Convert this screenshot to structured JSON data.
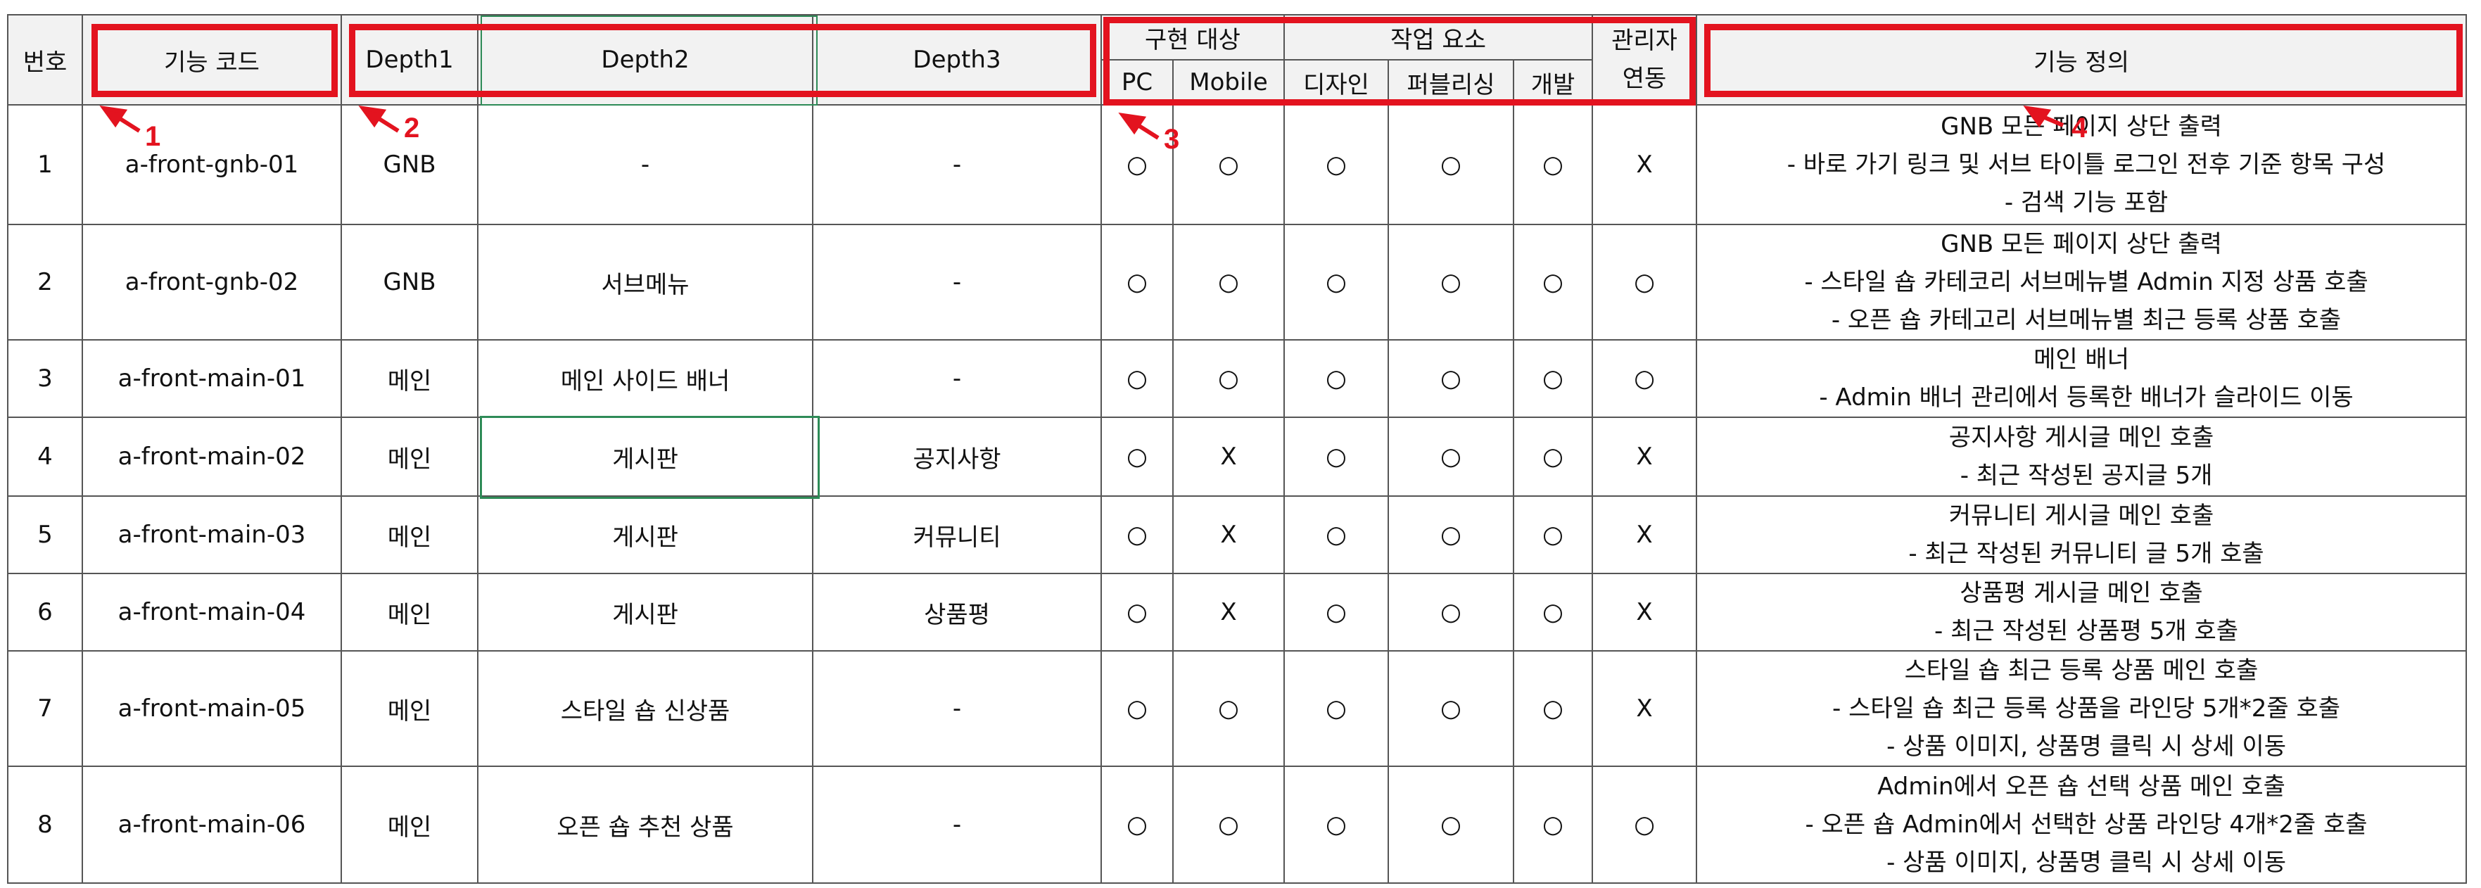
{
  "header": {
    "no": "번호",
    "code": "기능 코드",
    "depth1": "Depth1",
    "depth2": "Depth2",
    "depth3": "Depth3",
    "target_group": "구현 대상",
    "pc": "PC",
    "mobile": "Mobile",
    "work_group": "작업 요소",
    "design": "디자인",
    "publishing": "퍼블리싱",
    "dev": "개발",
    "admin_line1": "관리자",
    "admin_line2": "연동",
    "definition": "기능 정의"
  },
  "rows": [
    {
      "no": "1",
      "code": "a-front-gnb-01",
      "d1": "GNB",
      "d2": "-",
      "d3": "-",
      "pc": "○",
      "mobile": "○",
      "design": "○",
      "pub": "○",
      "dev": "○",
      "admin": "X",
      "def": [
        "GNB 모든 페이지 상단 출력",
        "- 바로 가기 링크 및 서브 타이틀 로그인 전후 기준 항목 구성",
        "- 검색 기능 포함"
      ]
    },
    {
      "no": "2",
      "code": "a-front-gnb-02",
      "d1": "GNB",
      "d2": "서브메뉴",
      "d3": "-",
      "pc": "○",
      "mobile": "○",
      "design": "○",
      "pub": "○",
      "dev": "○",
      "admin": "○",
      "def": [
        "GNB 모든 페이지 상단 출력",
        "- 스타일 숍 카테코리 서브메뉴별 Admin 지정 상품 호출",
        "- 오픈 숍 카테고리 서브메뉴별 최근 등록 상품 호출"
      ]
    },
    {
      "no": "3",
      "code": "a-front-main-01",
      "d1": "메인",
      "d2": "메인 사이드 배너",
      "d3": "-",
      "pc": "○",
      "mobile": "○",
      "design": "○",
      "pub": "○",
      "dev": "○",
      "admin": "○",
      "def": [
        "메인 배너",
        "- Admin 배너 관리에서 등록한 배너가 슬라이드 이동"
      ]
    },
    {
      "no": "4",
      "code": "a-front-main-02",
      "d1": "메인",
      "d2": "게시판",
      "d3": "공지사항",
      "pc": "○",
      "mobile": "X",
      "design": "○",
      "pub": "○",
      "dev": "○",
      "admin": "X",
      "def": [
        "공지사항 게시글 메인 호출",
        "- 최근 작성된 공지글 5개"
      ]
    },
    {
      "no": "5",
      "code": "a-front-main-03",
      "d1": "메인",
      "d2": "게시판",
      "d3": "커뮤니티",
      "pc": "○",
      "mobile": "X",
      "design": "○",
      "pub": "○",
      "dev": "○",
      "admin": "X",
      "def": [
        "커뮤니티 게시글 메인 호출",
        "- 최근 작성된 커뮤니티 글 5개 호출"
      ]
    },
    {
      "no": "6",
      "code": "a-front-main-04",
      "d1": "메인",
      "d2": "게시판",
      "d3": "상품평",
      "pc": "○",
      "mobile": "X",
      "design": "○",
      "pub": "○",
      "dev": "○",
      "admin": "X",
      "def": [
        "상품평 게시글 메인 호출",
        "- 최근 작성된 상품평 5개 호출"
      ]
    },
    {
      "no": "7",
      "code": "a-front-main-05",
      "d1": "메인",
      "d2": "스타일 숍 신상품",
      "d3": "-",
      "pc": "○",
      "mobile": "○",
      "design": "○",
      "pub": "○",
      "dev": "○",
      "admin": "X",
      "def": [
        "스타일 숍 최근 등록 상품 메인 호출",
        "- 스타일 숍 최근 등록 상품을 라인당 5개*2줄 호출",
        "- 상품 이미지, 상품명 클릭 시 상세 이동"
      ]
    },
    {
      "no": "8",
      "code": "a-front-main-06",
      "d1": "메인",
      "d2": "오픈 숍 추천 상품",
      "d3": "-",
      "pc": "○",
      "mobile": "○",
      "design": "○",
      "pub": "○",
      "dev": "○",
      "admin": "○",
      "def": [
        "Admin에서 오픈 숍 선택 상품 메인 호출",
        "- 오픈 숍 Admin에서 선택한 상품 라인당 4개*2줄 호출",
        "- 상품 이미지, 상품명 클릭 시 상세 이동"
      ]
    }
  ],
  "annotations": [
    "1",
    "2",
    "3",
    "4"
  ],
  "colors": {
    "annotation_red": "#e3131f",
    "header_bg": "#f2f2f2",
    "cell_highlight": "#2e8b57"
  }
}
